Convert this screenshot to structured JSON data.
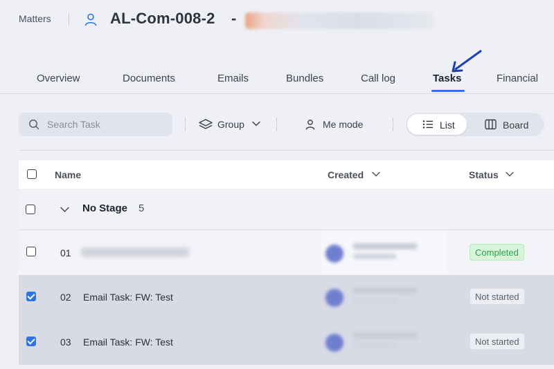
{
  "header": {
    "breadcrumb": "Matters",
    "matter_id": "AL-Com-008-2",
    "separator": "-"
  },
  "tabs": [
    {
      "label": "Overview"
    },
    {
      "label": "Documents"
    },
    {
      "label": "Emails"
    },
    {
      "label": "Bundles"
    },
    {
      "label": "Call log"
    },
    {
      "label": "Tasks",
      "active": true
    },
    {
      "label": "Financial"
    }
  ],
  "toolbar": {
    "search_placeholder": "Search Task",
    "group_label": "Group",
    "me_mode_label": "Me mode",
    "view_list_label": "List",
    "view_board_label": "Board",
    "active_view": "List"
  },
  "table": {
    "columns": {
      "name": "Name",
      "created": "Created",
      "status": "Status"
    },
    "group": {
      "title": "No Stage",
      "count": "5"
    },
    "rows": [
      {
        "num": "01",
        "name": "",
        "status": "Completed",
        "checked": false
      },
      {
        "num": "02",
        "name": "Email Task: FW: Test",
        "status": "Not started",
        "checked": true
      },
      {
        "num": "03",
        "name": "Email Task: FW: Test",
        "status": "Not started",
        "checked": true
      }
    ]
  },
  "colors": {
    "accent": "#2f73e0",
    "completed_bg": "#d6f5da",
    "completed_text": "#2f9e48",
    "selected_row": "#d8dae6"
  },
  "icons": {
    "user": "user-icon",
    "search": "search-icon",
    "group": "layers-icon",
    "me_mode": "person-icon",
    "list": "list-icon",
    "board": "board-columns-icon",
    "annotation": "arrow-pointer-icon"
  }
}
